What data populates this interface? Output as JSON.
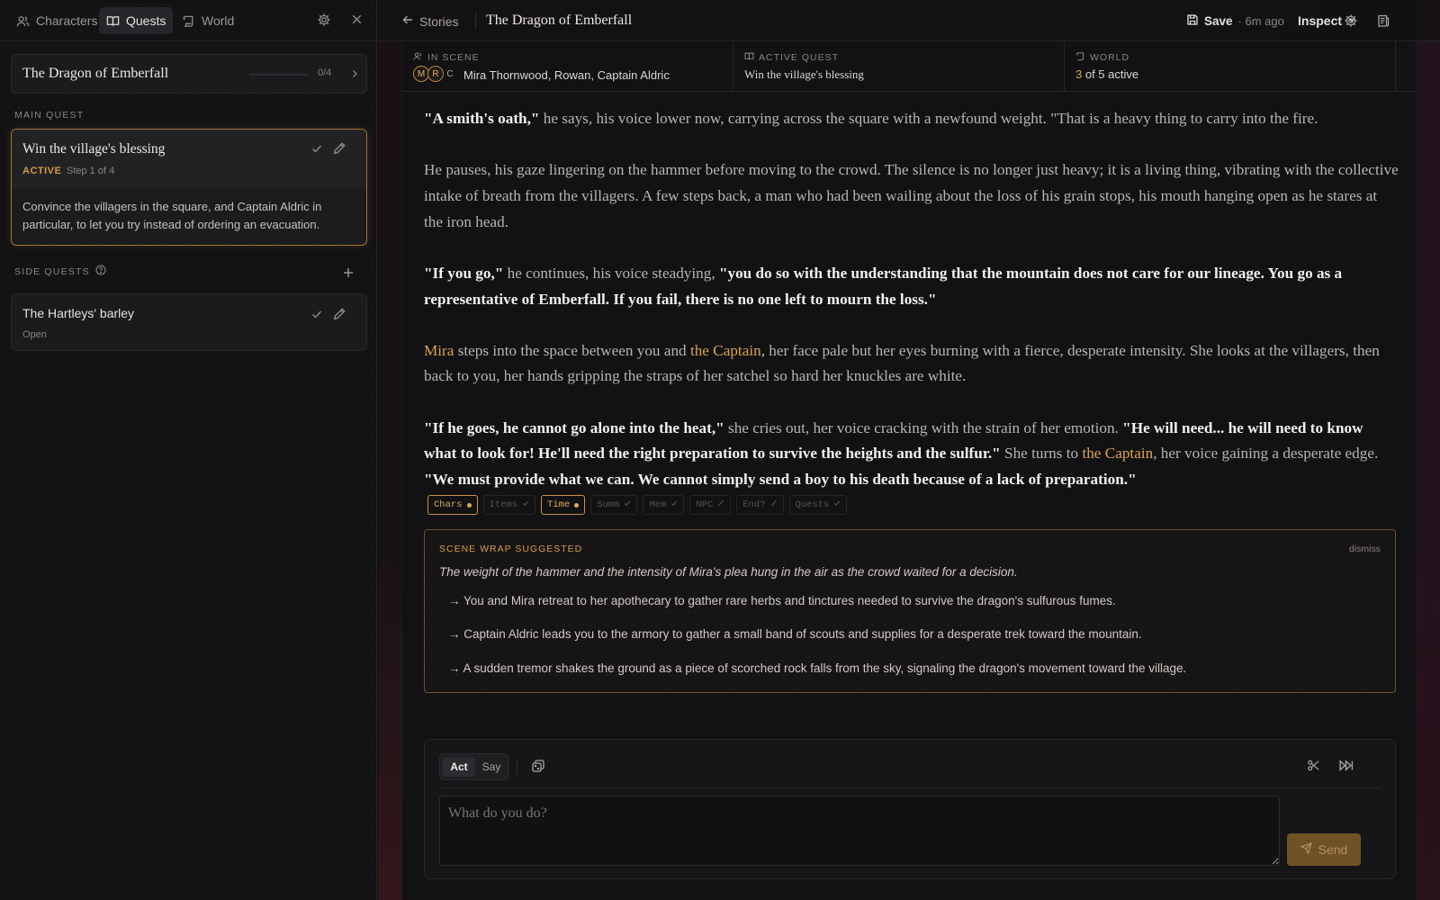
{
  "sidebar": {
    "tabs": [
      {
        "label": "Characters",
        "icon": "users-icon"
      },
      {
        "label": "Quests",
        "icon": "book-icon"
      },
      {
        "label": "World",
        "icon": "scroll-icon"
      }
    ],
    "active_tab": "Quests",
    "story": {
      "title": "The Dragon of Emberfall",
      "progress": "0/4",
      "progress_fraction": 0
    },
    "main_quest_label": "MAIN QUEST",
    "main_quest": {
      "title": "Win the village's blessing",
      "status": "ACTIVE",
      "step": "Step 1 of 4",
      "description": "Convince the villagers in the square, and Captain Aldric in particular, to let you try instead of ordering an evacuation."
    },
    "side_quests_label": "SIDE QUESTS",
    "side_quests": [
      {
        "title": "The Hartleys' barley",
        "status": "Open"
      }
    ]
  },
  "topbar": {
    "back_label": "Stories",
    "title": "The Dragon of Emberfall",
    "save_label": "Save",
    "save_ago": "· 6m ago",
    "inspect_label": "Inspect"
  },
  "scene": {
    "in_scene_label": "IN SCENE",
    "avatars": [
      "M",
      "R",
      "C"
    ],
    "cast": "Mira Thornwood, Rowan, Captain Aldric",
    "active_quest_label": "ACTIVE QUEST",
    "active_quest": "Win the village's blessing",
    "world_label": "WORLD",
    "world_count": "3",
    "world_suffix": " of 5 active"
  },
  "narrative": {
    "p1": {
      "q1": "\"A smith's oath,\"",
      "n1": " he says, his voice lower now, carrying across the square with a newfound weight. \"That is a heavy thing to carry into the fire."
    },
    "p2": {
      "n1": "He pauses, his gaze lingering on the hammer before moving to the crowd. The silence is no longer just heavy; it is a living thing, vibrating with the collective intake of breath from the villagers. A few steps back, a man who had been wailing about the loss of his grain stops, his mouth hanging open as he stares at the iron head."
    },
    "p3": {
      "q1": "\"If you go,\"",
      "n1": " he continues, his voice steadying, ",
      "q2": "\"you do so with the understanding that the mountain does not care for our lineage. You go as a representative of Emberfall. If you fail, there is no one left to mourn the loss.\""
    },
    "p4": {
      "npc1": "Mira",
      "n1": " steps into the space between you and ",
      "npc2": "the Captain",
      "n2": ", her face pale but her eyes burning with a fierce, desperate intensity. She looks at the villagers, then back to you, her hands gripping the straps of her satchel so hard her knuckles are white."
    },
    "p5": {
      "q1": "\"If he goes, he cannot go alone into the heat,\"",
      "n1": " she cries out, her voice cracking with the strain of her emotion. ",
      "q2": "\"He will need... he will need to know what to look for! He'll need the right preparation to survive the heights and the sulfur.\"",
      "n2": " She turns to ",
      "npc1": "the Captain",
      "n3": ", her voice gaining a desperate edge. ",
      "q3": "\"We must provide what we can. We cannot simply send a boy to his death because of a lack of preparation.\""
    }
  },
  "chips": [
    {
      "label": "Chars",
      "state": "active"
    },
    {
      "label": "Items",
      "state": "done"
    },
    {
      "label": "Time",
      "state": "active"
    },
    {
      "label": "Summ",
      "state": "done"
    },
    {
      "label": "Mem",
      "state": "done"
    },
    {
      "label": "NPC",
      "state": "skipped"
    },
    {
      "label": "End?",
      "state": "skipped"
    },
    {
      "label": "Quests",
      "state": "done"
    }
  ],
  "scene_wrap": {
    "label": "SCENE WRAP SUGGESTED",
    "dismiss": "dismiss",
    "summary": "The weight of the hammer and the intensity of Mira's plea hung in the air as the crowd waited for a decision.",
    "options": [
      "→ You and Mira retreat to her apothecary to gather rare herbs and tinctures needed to survive the dragon's sulfurous fumes.",
      "→ Captain Aldric leads you to the armory to gather a small band of scouts and supplies for a desperate trek toward the mountain.",
      "→ A sudden tremor shakes the ground as a piece of scorched rock falls from the sky, signaling the dragon's movement toward the village."
    ]
  },
  "composer": {
    "mode_act": "Act",
    "mode_say": "Say",
    "placeholder": "What do you do?",
    "send_label": "Send"
  },
  "colors": {
    "accent": "#d9a24e",
    "background": "#121214"
  }
}
